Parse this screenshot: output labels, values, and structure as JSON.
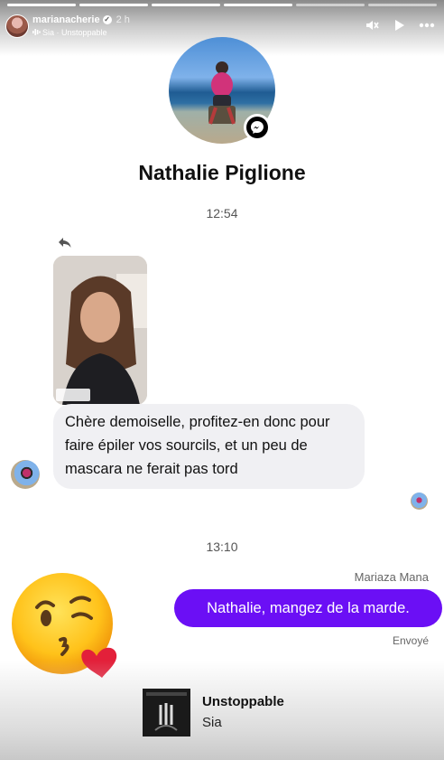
{
  "story": {
    "username": "marianacherie",
    "posted_ago": "2 h",
    "music_line": "Sia · Unstoppable",
    "controls": [
      "mute-icon",
      "play-icon",
      "more-icon"
    ]
  },
  "conversation": {
    "contact_name": "Nathalie Piglione",
    "first_timestamp": "12:54",
    "incoming_message": "Chère demoiselle, profitez-en donc pour faire épiler vos sourcils, et un peu de mascara ne ferait pas tord",
    "second_timestamp": "13:10",
    "outgoing_sender": "Mariaza Mana",
    "outgoing_message": "Nathalie, mangez de la marde.",
    "outgoing_status": "Envoyé",
    "outgoing_bubble_color": "#6b0ff5"
  },
  "music_sticker": {
    "title": "Unstoppable",
    "artist": "Sia"
  }
}
